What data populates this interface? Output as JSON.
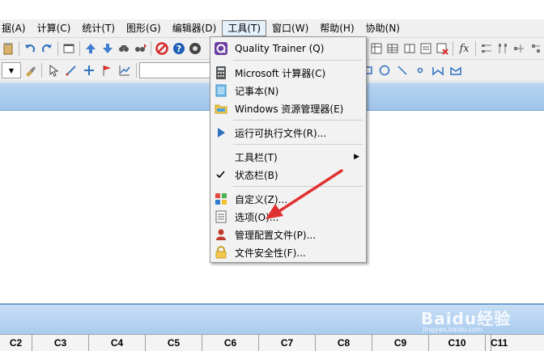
{
  "menubar": {
    "items": [
      {
        "label": "据(A)"
      },
      {
        "label": "计算(C)"
      },
      {
        "label": "统计(T)"
      },
      {
        "label": "图形(G)"
      },
      {
        "label": "编辑器(D)"
      },
      {
        "label": "工具(T)"
      },
      {
        "label": "窗口(W)"
      },
      {
        "label": "帮助(H)"
      },
      {
        "label": "协助(N)"
      }
    ]
  },
  "tools_menu": {
    "items": [
      {
        "label": "Quality Trainer (Q)",
        "icon": "quality-trainer-icon"
      },
      {
        "label": "Microsoft 计算器(C)",
        "icon": "calculator-icon"
      },
      {
        "label": "记事本(N)",
        "icon": "notepad-icon"
      },
      {
        "label": "Windows 资源管理器(E)",
        "icon": "folder-icon"
      },
      {
        "label": "运行可执行文件(R)...",
        "icon": "run-icon"
      },
      {
        "label": "工具栏(T)",
        "icon": "",
        "has_submenu": true
      },
      {
        "label": "状态栏(B)",
        "icon": "check-icon",
        "checked": true
      },
      {
        "label": "自定义(Z)...",
        "icon": "customize-icon"
      },
      {
        "label": "选项(O)...",
        "icon": "options-icon"
      },
      {
        "label": "管理配置文件(P)...",
        "icon": "profile-icon"
      },
      {
        "label": "文件安全性(F)...",
        "icon": "lock-icon"
      }
    ]
  },
  "worksheet": {
    "columns": [
      "C2",
      "C3",
      "C4",
      "C5",
      "C6",
      "C7",
      "C8",
      "C9",
      "C10",
      "C11"
    ]
  },
  "toolbar2": {
    "function_label": "fx"
  },
  "watermark": {
    "text": "Baidu经验",
    "sub": "jingyan.baidu.com"
  },
  "colors": {
    "menu_highlight": "#e5f1fb",
    "titlebar_blue": "#9ec3ea",
    "arrow_red": "#e03030"
  }
}
